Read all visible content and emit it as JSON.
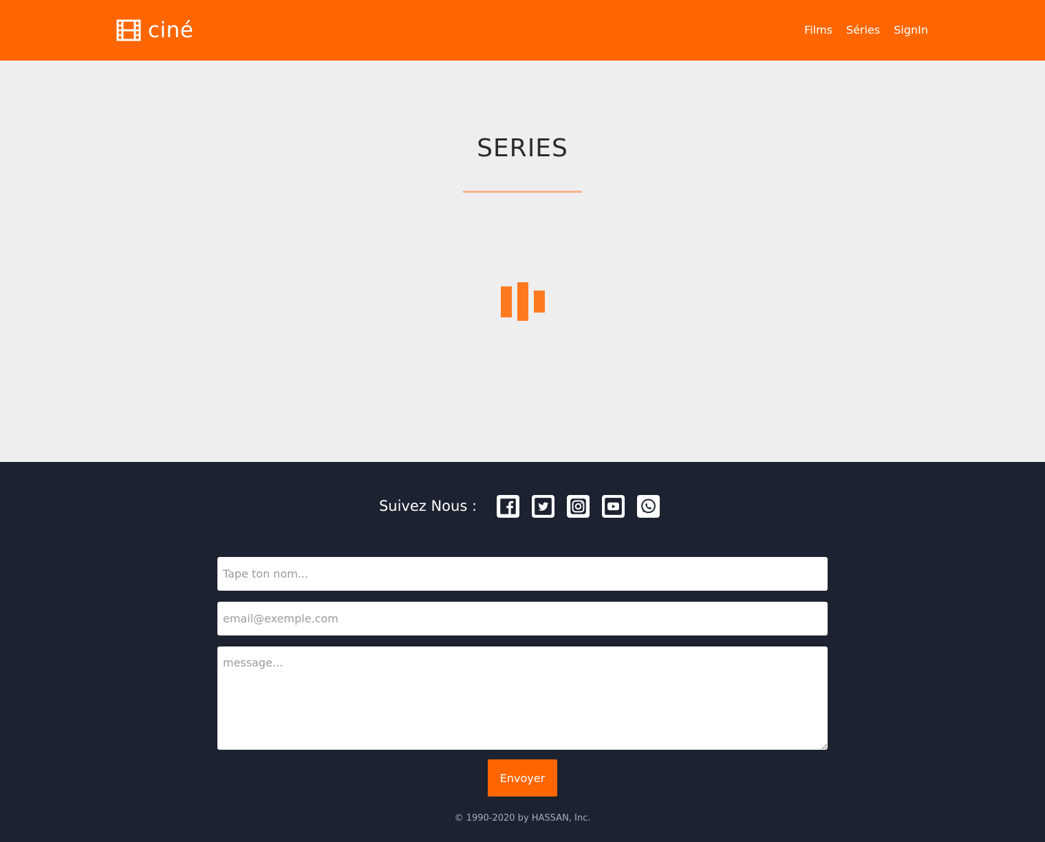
{
  "header": {
    "brand": {
      "icon": "film-icon",
      "text": "ciné"
    },
    "nav": [
      {
        "label": "Films"
      },
      {
        "label": "Séries"
      },
      {
        "label": "SignIn"
      }
    ],
    "background_color": "#ff6600"
  },
  "main": {
    "title": "SERIES",
    "loader": {
      "icon": "loading-bars-icon",
      "color": "#ff7a1f"
    }
  },
  "footer": {
    "follow_label": "Suivez Nous :",
    "social": [
      {
        "name": "facebook-icon"
      },
      {
        "name": "twitter-icon"
      },
      {
        "name": "instagram-icon"
      },
      {
        "name": "youtube-icon"
      },
      {
        "name": "whatsapp-icon"
      }
    ],
    "form": {
      "name_placeholder": "Tape ton nom...",
      "email_placeholder": "email@exemple.com",
      "message_placeholder": "message...",
      "submit_label": "Envoyer"
    },
    "copyright": "© 1990-2020 by HASSAN, Inc.",
    "background_color": "#1c2230"
  }
}
